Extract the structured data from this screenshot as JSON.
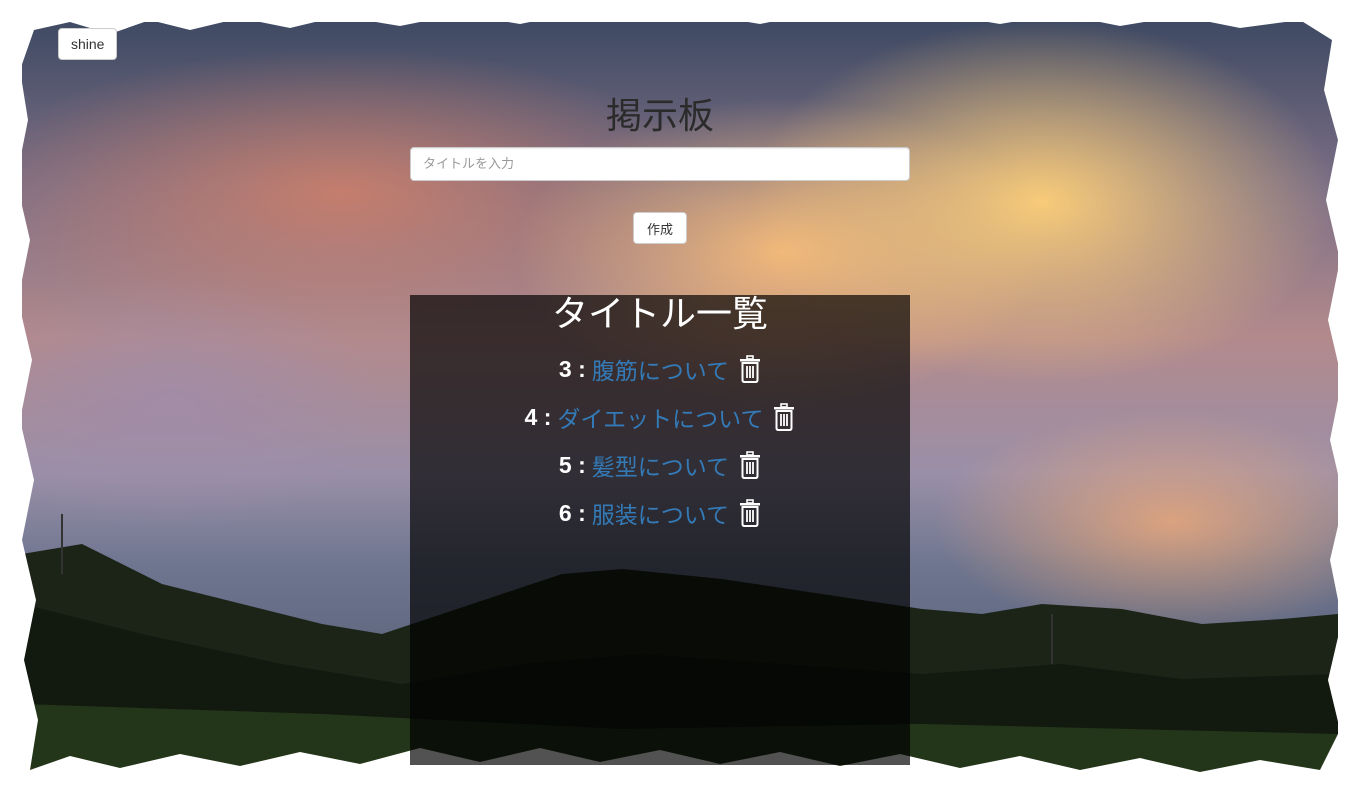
{
  "nav": {
    "shine_label": "shine"
  },
  "board": {
    "title": "掲示板",
    "input_placeholder": "タイトルを入力",
    "input_value": "",
    "create_label": "作成"
  },
  "list": {
    "heading": "タイトル一覧",
    "separator": ":",
    "items": [
      {
        "id": "3",
        "title": "腹筋について",
        "delete_icon": "trash-icon"
      },
      {
        "id": "4",
        "title": "ダイエットについて",
        "delete_icon": "trash-icon"
      },
      {
        "id": "5",
        "title": "髪型について",
        "delete_icon": "trash-icon"
      },
      {
        "id": "6",
        "title": "服装について",
        "delete_icon": "trash-icon"
      }
    ]
  },
  "colors": {
    "link": "#337ab7",
    "panel": "rgba(0,0,0,0.68)",
    "heading_dark": "#2b2b2b"
  }
}
